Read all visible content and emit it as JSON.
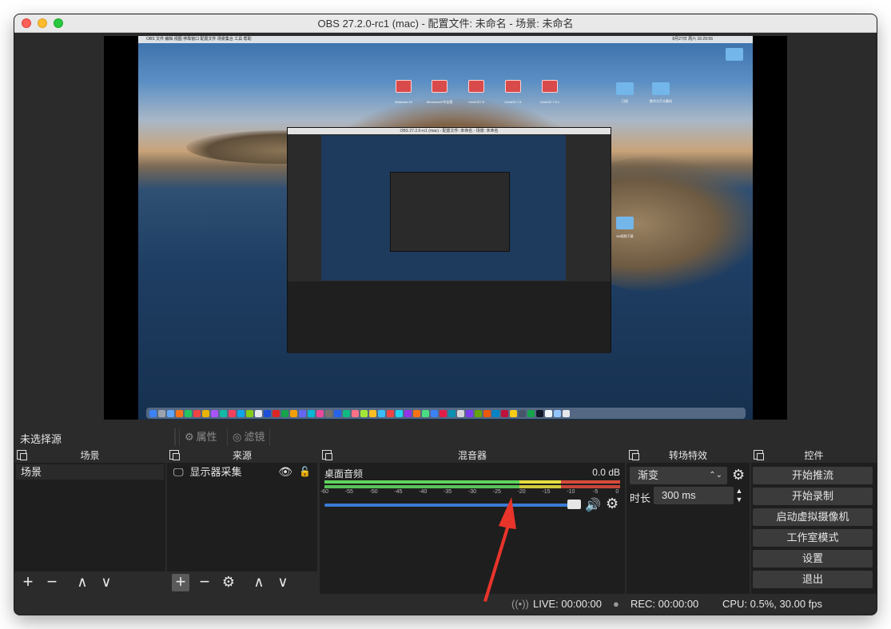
{
  "window": {
    "title": "OBS 27.2.0-rc1 (mac) - 配置文件: 未命名 - 场景: 未命名"
  },
  "preview": {
    "mac_menubar": "OBS  文件  编辑  视图  停靠窗口  配置文件  场景集合  工具  帮助",
    "mac_clock": "8月27日 周六 16:29:56",
    "desktop_icons": [
      "Windows 10",
      "Windows10专业版",
      "CentOS7.8",
      "CentOS 7.6",
      "CentOS 7.5.1"
    ],
    "folder_labels": [
      "日程",
      "数字大厅计算机",
      "Bili视频下载"
    ],
    "nested_title": "OBS 27.2.0-rc1 (mac) - 配置文件: 未命名 - 场景: 未命名"
  },
  "toolbar": {
    "no_source": "未选择源",
    "properties": "属性",
    "filters": "滤镜"
  },
  "scenes": {
    "header": "场景",
    "items": [
      "场景"
    ]
  },
  "sources": {
    "header": "来源",
    "items": [
      "显示器采集"
    ]
  },
  "mixer": {
    "header": "混音器",
    "track_name": "桌面音频",
    "db": "0.0 dB",
    "ticks": [
      "-60",
      "-55",
      "-50",
      "-45",
      "-40",
      "-35",
      "-30",
      "-25",
      "-20",
      "-15",
      "-10",
      "-5",
      "0"
    ]
  },
  "transitions": {
    "header": "转场特效",
    "selected": "渐变",
    "duration_label": "时长",
    "duration_value": "300 ms"
  },
  "controls": {
    "header": "控件",
    "buttons": [
      "开始推流",
      "开始录制",
      "启动虚拟摄像机",
      "工作室模式",
      "设置",
      "退出"
    ]
  },
  "status": {
    "live": "LIVE: 00:00:00",
    "rec": "REC: 00:00:00",
    "cpu": "CPU: 0.5%, 30.00 fps"
  },
  "colors": {
    "accent": "#3a7bd5",
    "meter_green": "#5fd55f",
    "meter_yellow": "#e4dd3f",
    "meter_red": "#d84b3b",
    "annotation_arrow": "#e8342a"
  }
}
